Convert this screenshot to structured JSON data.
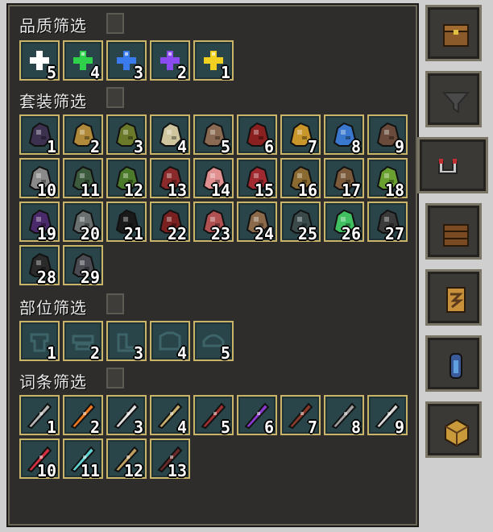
{
  "quality": {
    "title": "品质筛选",
    "items": [
      {
        "n": "5",
        "color": "#ffffff"
      },
      {
        "n": "4",
        "color": "#2fd14a"
      },
      {
        "n": "3",
        "color": "#3a7cf0"
      },
      {
        "n": "2",
        "color": "#8a4cf0"
      },
      {
        "n": "1",
        "color": "#f0d020"
      }
    ]
  },
  "set": {
    "title": "套装筛选",
    "items": [
      {
        "n": "1",
        "c": "#3d3150"
      },
      {
        "n": "2",
        "c": "#b08a3a"
      },
      {
        "n": "3",
        "c": "#6b7a2a"
      },
      {
        "n": "4",
        "c": "#cfc6a0"
      },
      {
        "n": "5",
        "c": "#8a6a52"
      },
      {
        "n": "6",
        "c": "#8a2020"
      },
      {
        "n": "7",
        "c": "#c8962a"
      },
      {
        "n": "8",
        "c": "#3a78d0"
      },
      {
        "n": "9",
        "c": "#6a4a3a"
      },
      {
        "n": "10",
        "c": "#8a8a8a"
      },
      {
        "n": "11",
        "c": "#3c5a3c"
      },
      {
        "n": "12",
        "c": "#4a7a2a"
      },
      {
        "n": "13",
        "c": "#8a2a2a"
      },
      {
        "n": "14",
        "c": "#e09090"
      },
      {
        "n": "15",
        "c": "#a02a30"
      },
      {
        "n": "16",
        "c": "#8a6a30"
      },
      {
        "n": "17",
        "c": "#7a5a3a"
      },
      {
        "n": "18",
        "c": "#6aa030"
      },
      {
        "n": "19",
        "c": "#4a2a6a"
      },
      {
        "n": "20",
        "c": "#6a7070"
      },
      {
        "n": "21",
        "c": "#1a1a1a"
      },
      {
        "n": "22",
        "c": "#7a2020"
      },
      {
        "n": "23",
        "c": "#b05050"
      },
      {
        "n": "24",
        "c": "#8a6a4a"
      },
      {
        "n": "25",
        "c": "#3a4a4a"
      },
      {
        "n": "26",
        "c": "#40c060"
      },
      {
        "n": "27",
        "c": "#3a3a3a"
      },
      {
        "n": "28",
        "c": "#2a2a2a"
      },
      {
        "n": "29",
        "c": "#4a4a52"
      }
    ]
  },
  "part": {
    "title": "部位筛选",
    "items": [
      {
        "n": "1"
      },
      {
        "n": "2"
      },
      {
        "n": "3"
      },
      {
        "n": "4"
      },
      {
        "n": "5"
      }
    ]
  },
  "affix": {
    "title": "词条筛选",
    "items": [
      {
        "n": "1",
        "c": "#b8b8b8"
      },
      {
        "n": "2",
        "c": "#f07820"
      },
      {
        "n": "3",
        "c": "#e0e0e0"
      },
      {
        "n": "4",
        "c": "#c8b070"
      },
      {
        "n": "5",
        "c": "#a03030"
      },
      {
        "n": "6",
        "c": "#8a3ad0"
      },
      {
        "n": "7",
        "c": "#8a3a2a"
      },
      {
        "n": "8",
        "c": "#a0a0a0"
      },
      {
        "n": "9",
        "c": "#d8d8d8"
      },
      {
        "n": "10",
        "c": "#d03040"
      },
      {
        "n": "11",
        "c": "#60d0d0"
      },
      {
        "n": "12",
        "c": "#c0a060"
      },
      {
        "n": "13",
        "c": "#6a2a2a"
      }
    ]
  },
  "tabs": [
    {
      "icon": "chest-icon"
    },
    {
      "icon": "funnel-icon"
    },
    {
      "icon": "magnet-icon"
    },
    {
      "icon": "crate-icon"
    },
    {
      "icon": "scroll-icon"
    },
    {
      "icon": "potion-icon"
    },
    {
      "icon": "cube-icon"
    }
  ]
}
